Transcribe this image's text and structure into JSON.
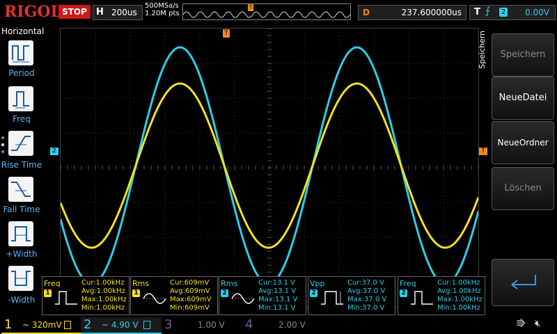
{
  "brand": "RIGOL",
  "run_state": "STOP",
  "horizontal": {
    "letter": "H",
    "timebase": "200us",
    "sample_rate": "500MSa/s",
    "points": "1.20M pts"
  },
  "delay": {
    "letter": "D",
    "value": "237.600000us"
  },
  "trigger": {
    "letter": "T",
    "source": "2",
    "level": "0.00V"
  },
  "left_panel": {
    "title": "Horizontal",
    "items": [
      {
        "label": "Period",
        "icon": "period-icon"
      },
      {
        "label": "Freq",
        "icon": "frequency-icon"
      },
      {
        "label": "Rise Time",
        "icon": "rise-time-icon"
      },
      {
        "label": "Fall Time",
        "icon": "fall-time-icon"
      },
      {
        "label": "+Width",
        "icon": "positive-width-icon"
      },
      {
        "label": "-Width",
        "icon": "negative-width-icon"
      }
    ]
  },
  "right_panel": {
    "title": "Speichern",
    "buttons": [
      {
        "label": "Speichern",
        "enabled": false
      },
      {
        "label": "NeueDatei",
        "enabled": true
      },
      {
        "label": "NeueOrdner",
        "enabled": true
      },
      {
        "label": "Löschen",
        "enabled": false
      }
    ]
  },
  "markers": {
    "trigger_pos": "T",
    "ch2_ref": "2"
  },
  "measurements": [
    {
      "name": "Freq",
      "ch": "1",
      "color": "#f5e21b",
      "cur": "Cur:1.00kHz",
      "avg": "Avg:1.00kHz",
      "max": "Max:1.00kHz",
      "min": "Min:1.00kHz",
      "icon": "frequency-icon"
    },
    {
      "name": "Rms",
      "ch": "1",
      "color": "#f5e21b",
      "cur": "Cur:609mV",
      "avg": "Avg:609mV",
      "max": "Max:609mV",
      "min": "Min:609mV",
      "icon": "rms-icon"
    },
    {
      "name": "Rms",
      "ch": "2",
      "color": "#2ad0e8",
      "cur": "Cur:13.1 V",
      "avg": "Avg:13.1 V",
      "max": "Max:13.1 V",
      "min": "Min:13.1 V",
      "icon": "rms-icon"
    },
    {
      "name": "Vpp",
      "ch": "2",
      "color": "#2ad0e8",
      "cur": "Cur:37.0 V",
      "avg": "Avg:37.0 V",
      "max": "Max:37.0 V",
      "min": "Min:37.0 V",
      "icon": "vpp-icon"
    },
    {
      "name": "Freq",
      "ch": "2",
      "color": "#2ad0e8",
      "cur": "Cur:1.00kHz",
      "avg": "Avg:1.00kHz",
      "max": "Max:1.00kHz",
      "min": "Min:1.00kHz",
      "icon": "frequency-icon"
    }
  ],
  "channels": [
    {
      "num": "1",
      "value": "~ 320mV",
      "color": "#f5e21b"
    },
    {
      "num": "2",
      "value": "~ 4.90 V",
      "color": "#2ad0e8"
    },
    {
      "num": "3",
      "value": "1.00 V",
      "color": "#7a5a8a"
    },
    {
      "num": "4",
      "value": "2.00 V",
      "color": "#5a6aa0"
    }
  ],
  "colors": {
    "ch1": "#f5e21b",
    "ch2": "#2ad0e8",
    "trigger": "#f08a1a",
    "accent": "#5ab4f0"
  }
}
